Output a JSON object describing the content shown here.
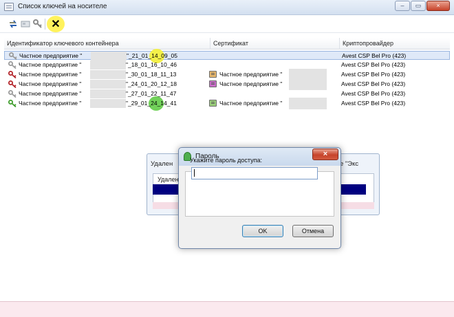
{
  "window": {
    "title": "Список ключей на носителе",
    "min": "–",
    "max": "▭",
    "close": "×"
  },
  "toolbar": {
    "items": [
      {
        "name": "refresh-icon",
        "color": "#2a5fb0"
      },
      {
        "name": "card-icon",
        "color": "#9aa3ad"
      },
      {
        "name": "key-tool-icon",
        "color": "#8a8a8a"
      },
      {
        "name": "delete-icon",
        "glyph": "✕"
      }
    ]
  },
  "table": {
    "columns": [
      "Идентификатор ключевого контейнера",
      "Сертификат",
      "Криптопровайдер"
    ],
    "rows": [
      {
        "id_prefix": "Частное предприятие \"",
        "id_suffix": "\"_21_01_14_09_05",
        "cert": "",
        "provider": "Avest CSP Bel Pro (423)",
        "key_color": "#9a9a9a",
        "selected": true,
        "mark": "#f3f04a"
      },
      {
        "id_prefix": "Частное предприятие \"",
        "id_suffix": "\"_18_01_16_10_46",
        "cert": "",
        "provider": "Avest CSP Bel Pro (423)",
        "key_color": "#9a9a9a",
        "selected": false,
        "mark": ""
      },
      {
        "id_prefix": "Частное предприятие \"",
        "id_suffix": "\"_30_01_18_11_13",
        "cert": "Частное предприятие \"",
        "provider": "Avest CSP Bel Pro (423)",
        "key_color": "#b3242a",
        "selected": false,
        "mark": "",
        "cert_color": "#e8b86d"
      },
      {
        "id_prefix": "Частное предприятие \"",
        "id_suffix": "\"_24_01_20_12_18",
        "cert": "Частное предприятие \"",
        "provider": "Avest CSP Bel Pro (423)",
        "key_color": "#b3242a",
        "selected": false,
        "mark": "",
        "cert_color": "#c86cc8"
      },
      {
        "id_prefix": "Частное предприятие \"",
        "id_suffix": "\"_27_01_22_11_47",
        "cert": "",
        "provider": "Avest CSP Bel Pro (423)",
        "key_color": "#9a9a9a",
        "selected": false,
        "mark": ""
      },
      {
        "id_prefix": "Частное предприятие \"",
        "id_suffix": "\"_29_01_24_14_41",
        "cert": "Частное предприятие \"",
        "provider": "Avest CSP Bel Pro (423)",
        "key_color": "#3f9d2d",
        "selected": false,
        "mark": "#72d15a",
        "cert_color": "#9bd07a"
      }
    ]
  },
  "bg_dialog": {
    "title_left": "Удален",
    "title_right": "е \"Экс",
    "label": "Удален"
  },
  "password_dialog": {
    "title": "Пароль",
    "close": "×",
    "prompt": "Укажите пароль доступа:",
    "value": "",
    "ok": "OK",
    "cancel": "Отмена"
  }
}
